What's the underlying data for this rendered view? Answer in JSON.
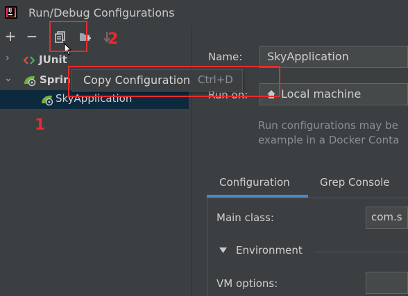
{
  "window": {
    "title": "Run/Debug Configurations"
  },
  "toolbar": {
    "add_glyph": "+",
    "remove_glyph": "−",
    "copy_icon": "copy-icon",
    "folder_icon": "folder-icon",
    "sort_icon": "sort-icon"
  },
  "tree": {
    "items": [
      {
        "label": "JUnit",
        "expanded": false
      },
      {
        "label": "Sprin",
        "expanded": true
      },
      {
        "label": "SkyApplication",
        "selected": true
      }
    ]
  },
  "popup": {
    "label": "Copy Configuration",
    "shortcut": "Ctrl+D"
  },
  "annotations": {
    "marker1": "1",
    "marker2": "2",
    "color": "#e82c2c"
  },
  "form": {
    "name_label": "Name:",
    "name_value": "SkyApplication",
    "run_on_label": "Run on:",
    "run_on_value": "Local machine",
    "desc_line1": "Run configurations may be",
    "desc_line2": "example in a Docker Conta",
    "tabs": [
      "Configuration",
      "Grep Console"
    ],
    "main_class_label": "Main class:",
    "main_class_value": "com.s",
    "environment_label": "Environment",
    "vm_options_label": "VM options:",
    "vm_options_value": ""
  },
  "colors": {
    "accent": "#4a88c7",
    "selection": "#0d293e",
    "background": "#3c3f41"
  }
}
